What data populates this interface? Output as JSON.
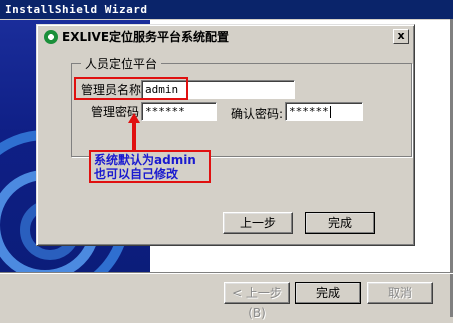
{
  "background_window": {
    "title": "InstallShield Wizard",
    "buttons": {
      "back_label": "< 上一步(B)",
      "finish_label": "完成",
      "cancel_label": "取消"
    }
  },
  "dialog": {
    "title": "EXLIVE定位服务平台系统配置",
    "close_glyph": "x",
    "group_title": "人员定位平台",
    "admin_name": {
      "label": "管理员名称:",
      "value": "admin"
    },
    "admin_password": {
      "label": "管理密码",
      "value": "******"
    },
    "confirm_password": {
      "label": "确认密码:",
      "value": "******"
    },
    "buttons": {
      "back_label": "上一步",
      "finish_label": "完成"
    }
  },
  "annotation": {
    "line1": "系统默认为admin",
    "line2": "也可以自己修改",
    "color": "#e01010"
  },
  "icons": [
    "app-logo-icon",
    "close-icon",
    "arrow-up-icon"
  ]
}
